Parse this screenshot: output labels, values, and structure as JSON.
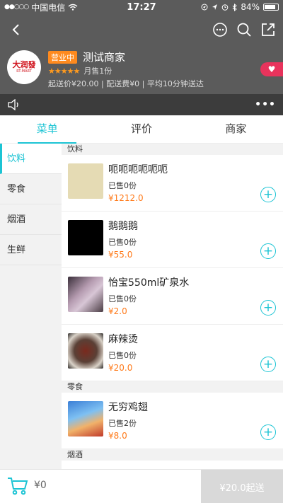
{
  "status": {
    "carrier": "中国电信",
    "time": "17:27",
    "battery": "84%"
  },
  "shop": {
    "logo_text": "大润發",
    "logo_sub": "RT-MART",
    "open_badge": "营业中",
    "name": "测试商家",
    "rating_stars": "★★★★★",
    "monthly_sales": "月售1份",
    "delivery_info": "起送价¥20.00 | 配送费¥0 | 平均10分钟送达"
  },
  "notice": {
    "more": "•••"
  },
  "tabs": [
    {
      "label": "菜单",
      "active": true
    },
    {
      "label": "评价",
      "active": false
    },
    {
      "label": "商家",
      "active": false
    }
  ],
  "categories": [
    {
      "label": "饮料",
      "active": true
    },
    {
      "label": "零食",
      "active": false
    },
    {
      "label": "烟酒",
      "active": false
    },
    {
      "label": "生鲜",
      "active": false
    }
  ],
  "sections": [
    {
      "title": "饮料",
      "items": [
        {
          "name": "呃呃呃呃呃呃",
          "sold": "已售0份",
          "price": "¥1212.0",
          "image_color": "#e5dbb4"
        },
        {
          "name": "鹅鹅鹅",
          "sold": "已售0份",
          "price": "¥55.0",
          "image_color": "#000000"
        },
        {
          "name": "怡宝550ml矿泉水",
          "sold": "已售0份",
          "price": "¥2.0",
          "image_color": "#b59bb0"
        },
        {
          "name": "麻辣烫",
          "sold": "已售0份",
          "price": "¥20.0",
          "image_color": "#5a4036"
        }
      ]
    },
    {
      "title": "零食",
      "items": [
        {
          "name": "无穷鸡翅",
          "sold": "已售2份",
          "price": "¥8.0",
          "image_color": "#3b7fd6"
        }
      ]
    },
    {
      "title": "烟酒",
      "items": []
    }
  ],
  "cart": {
    "total": "¥0",
    "checkout": "¥20.0起送"
  },
  "colors": {
    "accent": "#1cc4d4",
    "price": "#ff7a1a",
    "header_bg": "#5b5b5b"
  }
}
